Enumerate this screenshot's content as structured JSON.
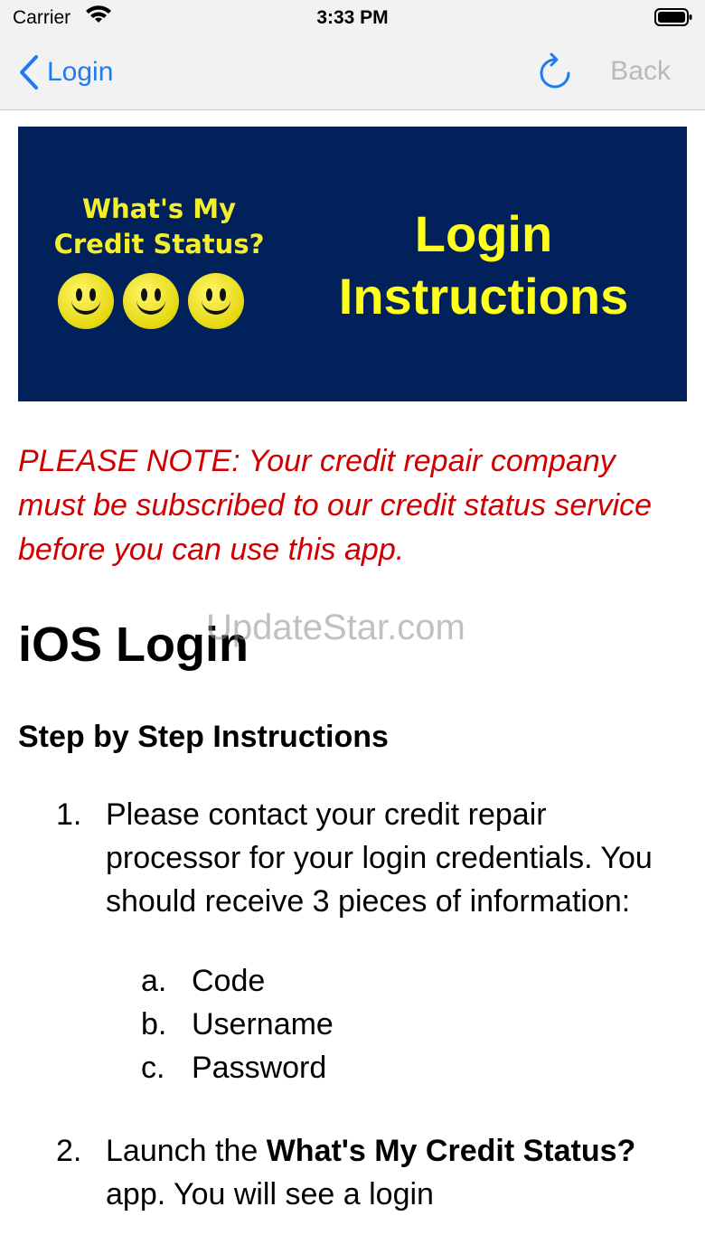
{
  "status_bar": {
    "carrier": "Carrier",
    "time": "3:33 PM"
  },
  "nav": {
    "back_label": "Login",
    "right_back_label": "Back",
    "accent_color": "#1e7cf2"
  },
  "banner": {
    "logo_line1": "What's My",
    "logo_line2": "Credit Status?",
    "title_line1": "Login",
    "title_line2": "Instructions"
  },
  "note": "PLEASE NOTE: Your credit repair company must be subscribed to our credit status service before you can use this app.",
  "heading": "iOS Login",
  "watermark": "UpdateStar.com",
  "subheading": "Step by Step Instructions",
  "steps": [
    {
      "number": "1.",
      "text": "Please contact your credit repair processor for your login credentials. You should receive 3 pieces of information:",
      "sub_items": [
        {
          "letter": "a.",
          "text": "Code"
        },
        {
          "letter": "b.",
          "text": "Username"
        },
        {
          "letter": "c.",
          "text": "Password"
        }
      ]
    },
    {
      "number": "2.",
      "text_before": "Launch the ",
      "bold": "What's My Credit Status?",
      "text_after": " app. You will see a login"
    }
  ]
}
